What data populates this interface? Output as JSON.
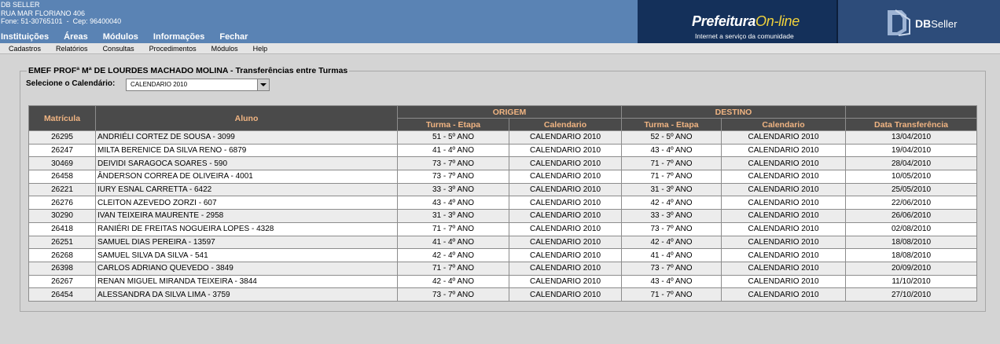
{
  "header": {
    "company": "DB SELLER",
    "address": "RUA MAR FLORIANO 406",
    "phone_line": "Fone: 51-30765101  -  Cep: 96400040",
    "menu": [
      "Instituições",
      "Áreas",
      "Módulos",
      "Informações",
      "Fechar"
    ],
    "logo_prefeitura": {
      "main": "Prefeitura",
      "accent": "On-line",
      "tagline": "Internet a serviço da comunidade"
    },
    "logo_dbseller": {
      "db": "DB",
      "seller": "Seller"
    }
  },
  "submenu": [
    "Cadastros",
    "Relatórios",
    "Consultas",
    "Procedimentos",
    "Módulos",
    "Help"
  ],
  "panel": {
    "legend": "EMEF PROFª Mª DE LOURDES MACHADO MOLINA - Transferências entre Turmas",
    "calendar_label": "Selecione o Calendário:",
    "calendar_value": "CALENDARIO 2010"
  },
  "table": {
    "headers": {
      "matricula": "Matrícula",
      "aluno": "Aluno",
      "origem": "ORIGEM",
      "destino": "DESTINO",
      "turma_etapa": "Turma - Etapa",
      "calendario": "Calendario",
      "data": "Data Transferência"
    },
    "rows": [
      [
        "26295",
        "ANDRIÉLI CORTEZ DE SOUSA - 3099",
        "51 - 5º ANO",
        "CALENDARIO 2010",
        "52 - 5º ANO",
        "CALENDARIO 2010",
        "13/04/2010"
      ],
      [
        "26247",
        "MILTA BERENICE DA SILVA RENO - 6879",
        "41 - 4º ANO",
        "CALENDARIO 2010",
        "43 - 4º ANO",
        "CALENDARIO 2010",
        "19/04/2010"
      ],
      [
        "30469",
        "DEIVIDI SARAGOCA SOARES - 590",
        "73 - 7º ANO",
        "CALENDARIO 2010",
        "71 - 7º ANO",
        "CALENDARIO 2010",
        "28/04/2010"
      ],
      [
        "26458",
        "ÂNDERSON CORREA DE OLIVEIRA - 4001",
        "73 - 7º ANO",
        "CALENDARIO 2010",
        "71 - 7º ANO",
        "CALENDARIO 2010",
        "10/05/2010"
      ],
      [
        "26221",
        "IURY ESNAL CARRETTA - 6422",
        "33 - 3º ANO",
        "CALENDARIO 2010",
        "31 - 3º ANO",
        "CALENDARIO 2010",
        "25/05/2010"
      ],
      [
        "26276",
        "CLEITON AZEVEDO ZORZI - 607",
        "43 - 4º ANO",
        "CALENDARIO 2010",
        "42 - 4º ANO",
        "CALENDARIO 2010",
        "22/06/2010"
      ],
      [
        "30290",
        "IVAN TEIXEIRA MAURENTE - 2958",
        "31 - 3º ANO",
        "CALENDARIO 2010",
        "33 - 3º ANO",
        "CALENDARIO 2010",
        "26/06/2010"
      ],
      [
        "26418",
        "RANIÉRI DE FREITAS NOGUEIRA LOPES - 4328",
        "71 - 7º ANO",
        "CALENDARIO 2010",
        "73 - 7º ANO",
        "CALENDARIO 2010",
        "02/08/2010"
      ],
      [
        "26251",
        "SAMUEL DIAS PEREIRA - 13597",
        "41 - 4º ANO",
        "CALENDARIO 2010",
        "42 - 4º ANO",
        "CALENDARIO 2010",
        "18/08/2010"
      ],
      [
        "26268",
        "SAMUEL SILVA DA SILVA - 541",
        "42 - 4º ANO",
        "CALENDARIO 2010",
        "41 - 4º ANO",
        "CALENDARIO 2010",
        "18/08/2010"
      ],
      [
        "26398",
        "CARLOS ADRIANO QUEVEDO - 3849",
        "71 - 7º ANO",
        "CALENDARIO 2010",
        "73 - 7º ANO",
        "CALENDARIO 2010",
        "20/09/2010"
      ],
      [
        "26267",
        "RENAN MIGUEL MIRANDA TEIXEIRA - 3844",
        "42 - 4º ANO",
        "CALENDARIO 2010",
        "43 - 4º ANO",
        "CALENDARIO 2010",
        "11/10/2010"
      ],
      [
        "26454",
        "ALESSANDRA DA SILVA LIMA - 3759",
        "73 - 7º ANO",
        "CALENDARIO 2010",
        "71 - 7º ANO",
        "CALENDARIO 2010",
        "27/10/2010"
      ]
    ]
  }
}
